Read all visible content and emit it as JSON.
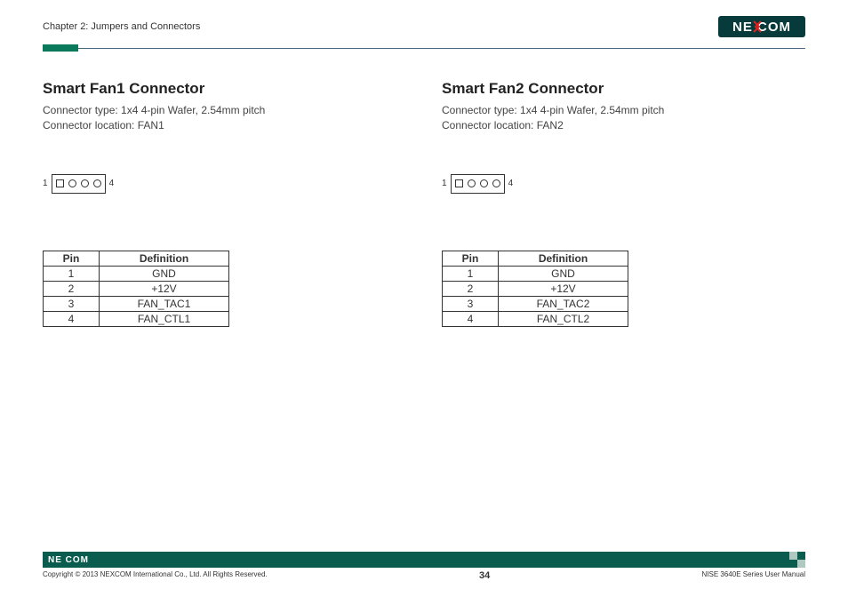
{
  "header": {
    "chapter": "Chapter 2: Jumpers and Connectors",
    "brand": "NEXCOM"
  },
  "sections": [
    {
      "title": "Smart Fan1 Connector",
      "connector_type": "Connector type: 1x4 4-pin Wafer, 2.54mm pitch",
      "connector_location": "Connector location: FAN1",
      "diagram": {
        "left_label": "1",
        "right_label": "4"
      },
      "table": {
        "headers": [
          "Pin",
          "Definition"
        ],
        "rows": [
          [
            "1",
            "GND"
          ],
          [
            "2",
            "+12V"
          ],
          [
            "3",
            "FAN_TAC1"
          ],
          [
            "4",
            "FAN_CTL1"
          ]
        ]
      }
    },
    {
      "title": "Smart Fan2 Connector",
      "connector_type": "Connector type: 1x4 4-pin Wafer, 2.54mm pitch",
      "connector_location": "Connector location: FAN2",
      "diagram": {
        "left_label": "1",
        "right_label": "4"
      },
      "table": {
        "headers": [
          "Pin",
          "Definition"
        ],
        "rows": [
          [
            "1",
            "GND"
          ],
          [
            "2",
            "+12V"
          ],
          [
            "3",
            "FAN_TAC2"
          ],
          [
            "4",
            "FAN_CTL2"
          ]
        ]
      }
    }
  ],
  "footer": {
    "brand_small": "NE COM",
    "copyright": "Copyright © 2013 NEXCOM International Co., Ltd. All Rights Reserved.",
    "page_number": "34",
    "doc_name": "NISE 3640E Series User Manual"
  }
}
